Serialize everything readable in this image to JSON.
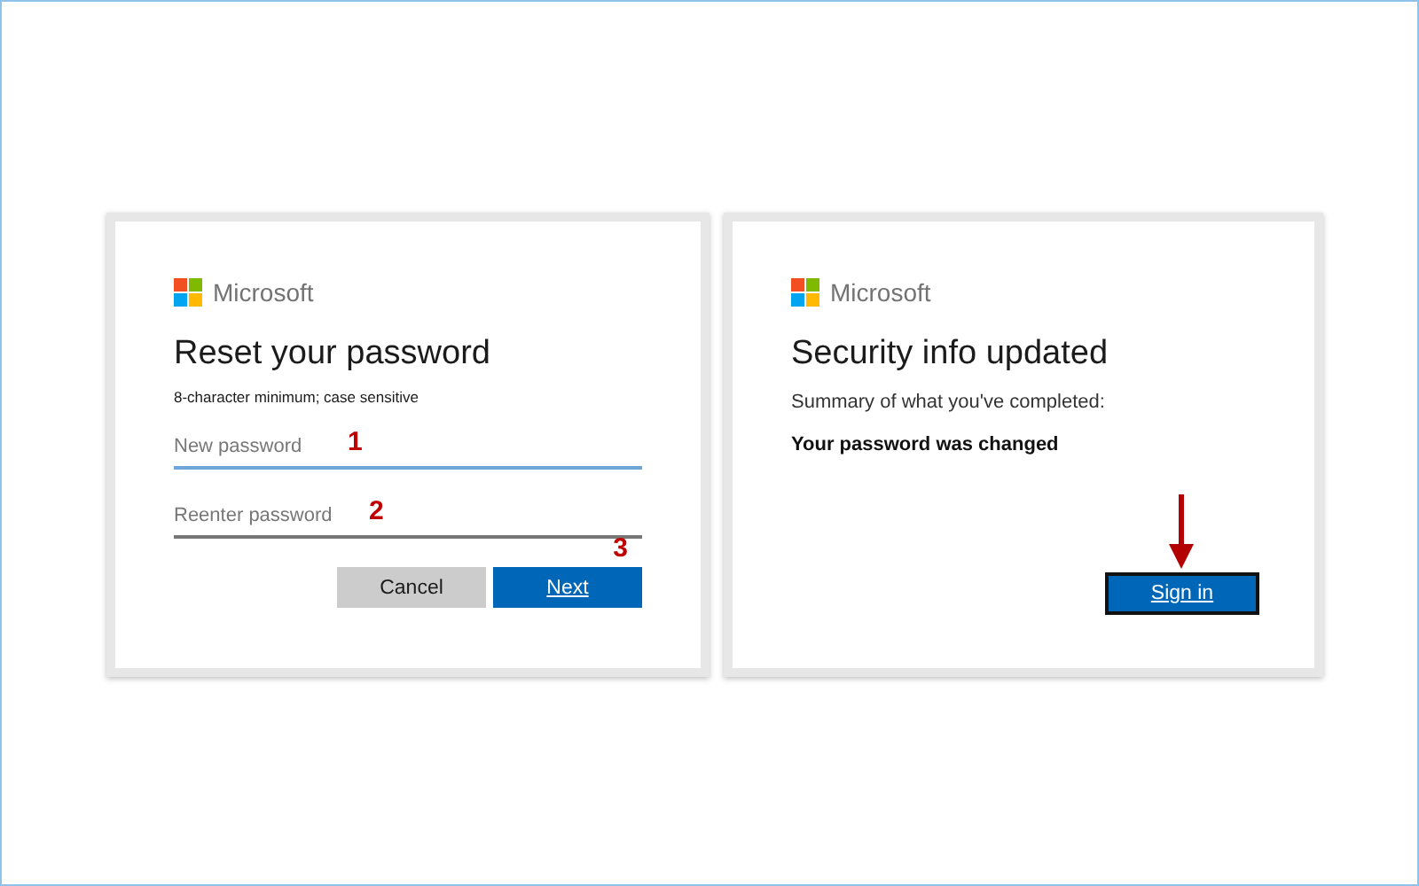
{
  "reset_card": {
    "brand": "Microsoft",
    "title": "Reset your password",
    "hint": "8-character minimum; case sensitive",
    "fields": [
      {
        "placeholder": "New password",
        "focused": true,
        "annotation": "1"
      },
      {
        "placeholder": "Reenter password",
        "focused": false,
        "annotation": "2"
      }
    ],
    "buttons": [
      {
        "label": "Cancel",
        "kind": "secondary"
      },
      {
        "label": "Next",
        "kind": "primary",
        "annotation": "3"
      }
    ]
  },
  "updated_card": {
    "brand": "Microsoft",
    "title": "Security info updated",
    "summary": "Summary of what you've completed:",
    "result": "Your password was changed",
    "button": {
      "label": "Sign in",
      "kind": "primary",
      "highlighted": true
    }
  }
}
